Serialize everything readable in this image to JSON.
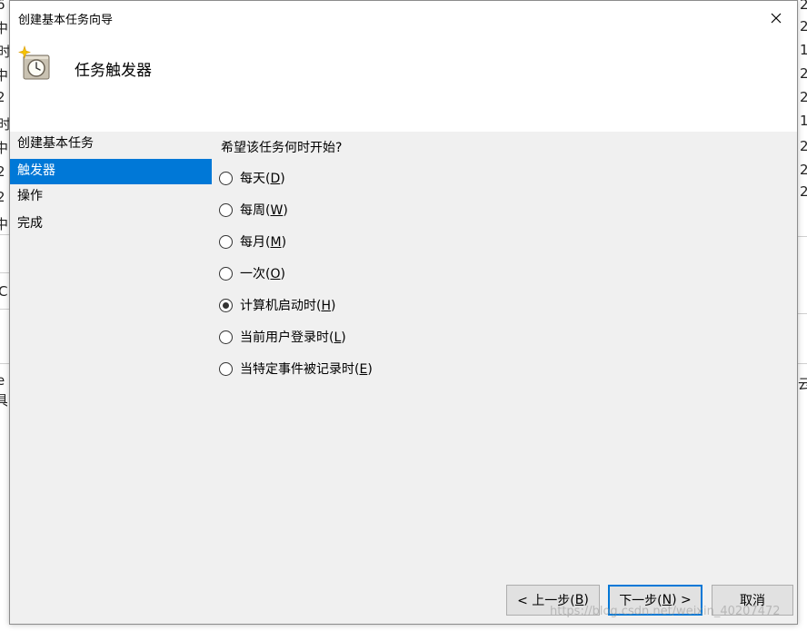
{
  "window": {
    "title": "创建基本任务向导",
    "close_glyph": "✕"
  },
  "header": {
    "title": "任务触发器",
    "icon": "clock-icon"
  },
  "steps": [
    {
      "label": "创建基本任务"
    },
    {
      "label": "触发器"
    },
    {
      "label": "操作"
    },
    {
      "label": "完成"
    }
  ],
  "main": {
    "question": "希望该任务何时开始?",
    "options": [
      {
        "label": "每天(",
        "key": "D",
        "close": ")",
        "checked": false
      },
      {
        "label": "每周(",
        "key": "W",
        "close": ")",
        "checked": false
      },
      {
        "label": "每月(",
        "key": "M",
        "close": ")",
        "checked": false
      },
      {
        "label": "一次(",
        "key": "O",
        "close": ")",
        "checked": false
      },
      {
        "label": "计算机启动时(",
        "key": "H",
        "close": ")",
        "checked": true
      },
      {
        "label": "当前用户登录时(",
        "key": "L",
        "close": ")",
        "checked": false
      },
      {
        "label": "当特定事件被记录时(",
        "key": "E",
        "close": ")",
        "checked": false
      }
    ]
  },
  "buttons": {
    "back": {
      "pre": "< 上一步(",
      "key": "B",
      "post": ")"
    },
    "next": {
      "pre": "下一步(",
      "key": "N",
      "post": ") >"
    },
    "cancel": "取消"
  },
  "watermark": "https://blog.csdn.net/weixin_40207472",
  "background": {
    "left_glyphs": [
      "6",
      "中",
      "时",
      "中",
      "2",
      "时",
      "中",
      "2",
      "2",
      "中",
      "C",
      "e",
      "具"
    ],
    "right_glyphs": [
      "2",
      "2",
      "1",
      "2",
      "2",
      "1",
      "2",
      "2",
      "2",
      "云"
    ]
  }
}
